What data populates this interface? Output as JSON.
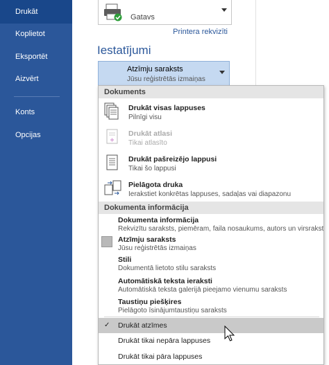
{
  "nav": {
    "items": [
      {
        "label": "Drukāt"
      },
      {
        "label": "Koplietot"
      },
      {
        "label": "Eksportēt"
      },
      {
        "label": "Aizvērt"
      },
      {
        "label": "Konts"
      },
      {
        "label": "Opcijas"
      }
    ]
  },
  "printer": {
    "status": "Gatavs",
    "properties_link": "Printera rekvizīti"
  },
  "settings": {
    "title": "Iestatījumi",
    "selected_title": "Atzīmju saraksts",
    "selected_sub": "Jūsu reģistrētās izmaiņas"
  },
  "menu": {
    "section_documents": "Dokuments",
    "items": [
      {
        "title": "Drukāt visas lappuses",
        "sub": "Pilnīgi visu"
      },
      {
        "title": "Drukāt atlasi",
        "sub": "Tikai atlasīto"
      },
      {
        "title": "Drukāt pašreizējo lappusi",
        "sub": "Tikai šo lappusi"
      },
      {
        "title": "Pielāgota druka",
        "sub": "Ierakstiet konkrētas lappuses, sadaļas vai diapazonu"
      }
    ],
    "section_info": "Dokumenta informācija",
    "info_items": [
      {
        "title": "Dokumenta informācija",
        "sub": "Rekvizītu saraksts, piemēram, faila nosaukums, autors un virsraksts"
      },
      {
        "title": "Atzīmju saraksts",
        "sub": "Jūsu reģistrētās izmaiņas"
      },
      {
        "title": "Stili",
        "sub": "Dokumentā lietoto stilu saraksts"
      },
      {
        "title": "Automātiskā teksta ieraksti",
        "sub": "Automātiskā teksta galerijā pieejamo vienumu saraksts"
      },
      {
        "title": "Taustiņu piešķires",
        "sub": "Pielāgoto īsinājumtaustiņu saraksts"
      }
    ],
    "options": [
      {
        "label": "Drukāt atzīmes",
        "checked": true
      },
      {
        "label": "Drukāt tikai nepāra lappuses"
      },
      {
        "label": "Drukāt tikai pāra lappuses"
      }
    ]
  },
  "colors": {
    "nav_bg": "#2b579a",
    "accent": "#2b579a",
    "selected_bg": "#c5d9f1"
  }
}
